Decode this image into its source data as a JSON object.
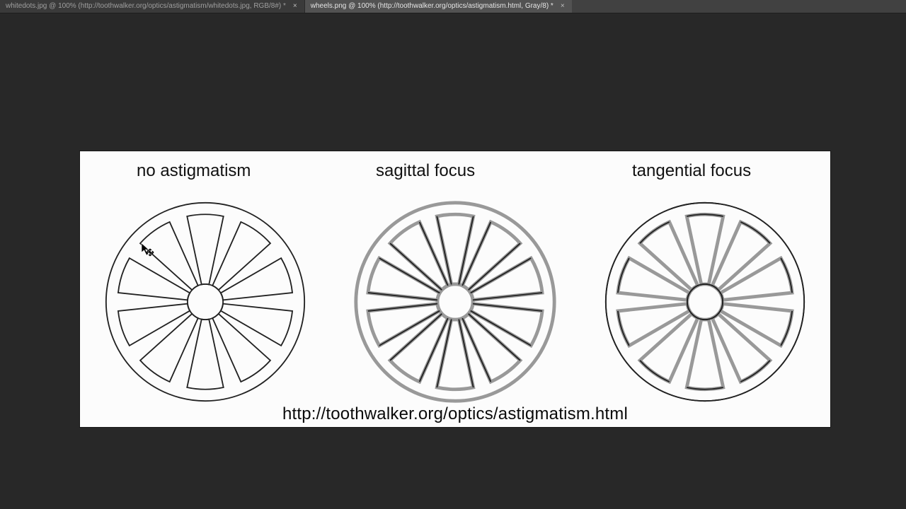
{
  "tabs": [
    {
      "label": "whitedots.jpg @ 100% (http://toothwalker.org/optics/astigmatism/whitedots.jpg, RGB/8#) *",
      "active": false
    },
    {
      "label": "wheels.png @ 100% (http://toothwalker.org/optics/astigmatism.html, Gray/8) *",
      "active": true
    }
  ],
  "close_glyph": "×",
  "document": {
    "titles": [
      "no astigmatism",
      "sagittal focus",
      "tangential focus"
    ],
    "caption": "http://toothwalker.org/optics/astigmatism.html"
  },
  "cursor": {
    "name": "move-cursor"
  }
}
